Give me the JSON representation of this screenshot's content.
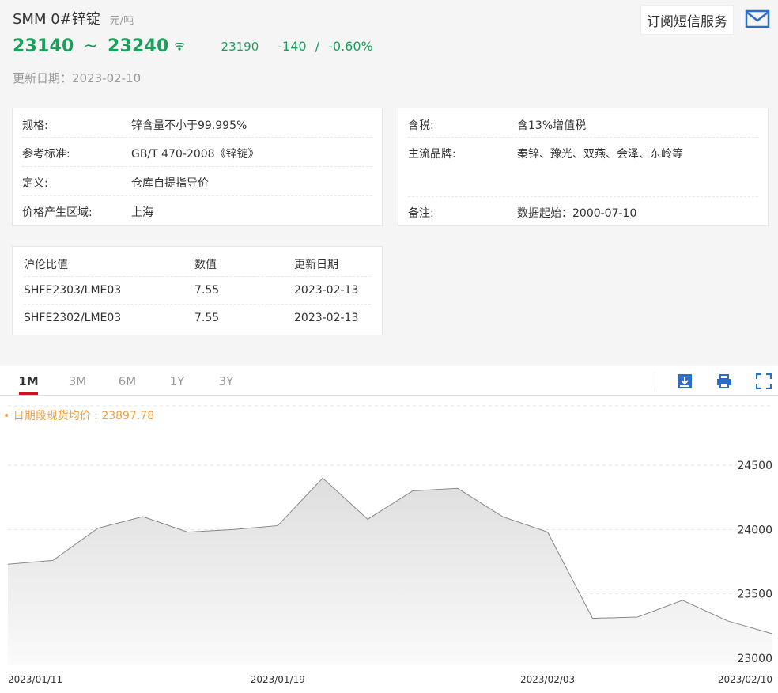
{
  "header": {
    "title": "SMM 0#锌锭",
    "unit": "元/吨",
    "subscribe_label": "订阅短信服务",
    "mail_icon": "mail-icon"
  },
  "price": {
    "low": "23140",
    "tilde": "~",
    "high": "23240",
    "average": "23190",
    "change": "-140",
    "sep": "/",
    "change_pct": "-0.60%",
    "color": "#1a9f5c"
  },
  "updated": "更新日期：2023-02-10",
  "spec_left": [
    {
      "label": "规格:",
      "value": "锌含量不小于99.995%"
    },
    {
      "label": "参考标准:",
      "value": "GB/T 470-2008《锌锭》"
    },
    {
      "label": "定义:",
      "value": "仓库自提指导价"
    },
    {
      "label": "价格产生区域:",
      "value": "上海"
    }
  ],
  "spec_right": [
    {
      "label": "含税:",
      "value": "含13%增值税"
    },
    {
      "label": "主流品牌:",
      "value": "秦锌、豫光、双燕、会泽、东岭等"
    },
    {
      "label": "备注:",
      "value": "数据起始：2000-07-10"
    }
  ],
  "ratio_table": {
    "headers": [
      "沪伦比值",
      "数值",
      "更新日期"
    ],
    "rows": [
      [
        "SHFE2303/LME03",
        "7.55",
        "2023-02-13"
      ],
      [
        "SHFE2302/LME03",
        "7.55",
        "2023-02-13"
      ]
    ]
  },
  "tabs": [
    {
      "label": "1M",
      "active": true
    },
    {
      "label": "3M",
      "active": false
    },
    {
      "label": "6M",
      "active": false
    },
    {
      "label": "1Y",
      "active": false
    },
    {
      "label": "3Y",
      "active": false
    }
  ],
  "tools": [
    "download-icon",
    "print-icon",
    "fullscreen-icon"
  ],
  "accent": "#c8141e",
  "legend_text": "• 日期段现货均价 : 23897.78",
  "chart_data": {
    "type": "area",
    "x": [
      "2023/01/11",
      "2023/01/12",
      "2023/01/13",
      "2023/01/16",
      "2023/01/17",
      "2023/01/18",
      "2023/01/19",
      "2023/01/20",
      "2023/01/30",
      "2023/01/31",
      "2023/02/01",
      "2023/02/02",
      "2023/02/03",
      "2023/02/06",
      "2023/02/07",
      "2023/02/08",
      "2023/02/09",
      "2023/02/10"
    ],
    "values": [
      23730,
      23760,
      24010,
      24100,
      23980,
      24000,
      24030,
      24400,
      24080,
      24300,
      24320,
      24100,
      23980,
      23310,
      23320,
      23450,
      23290,
      23190
    ],
    "x_ticks": [
      "2023/01/11",
      "2023/01/19",
      "2023/02/03",
      "2023/02/10"
    ],
    "y_ticks": [
      "24500",
      "24000",
      "23500",
      "23000"
    ],
    "ylim": [
      23000,
      24500
    ],
    "average": 23897.78,
    "line_color": "#888888",
    "fill_color": "#e8e8e8"
  }
}
